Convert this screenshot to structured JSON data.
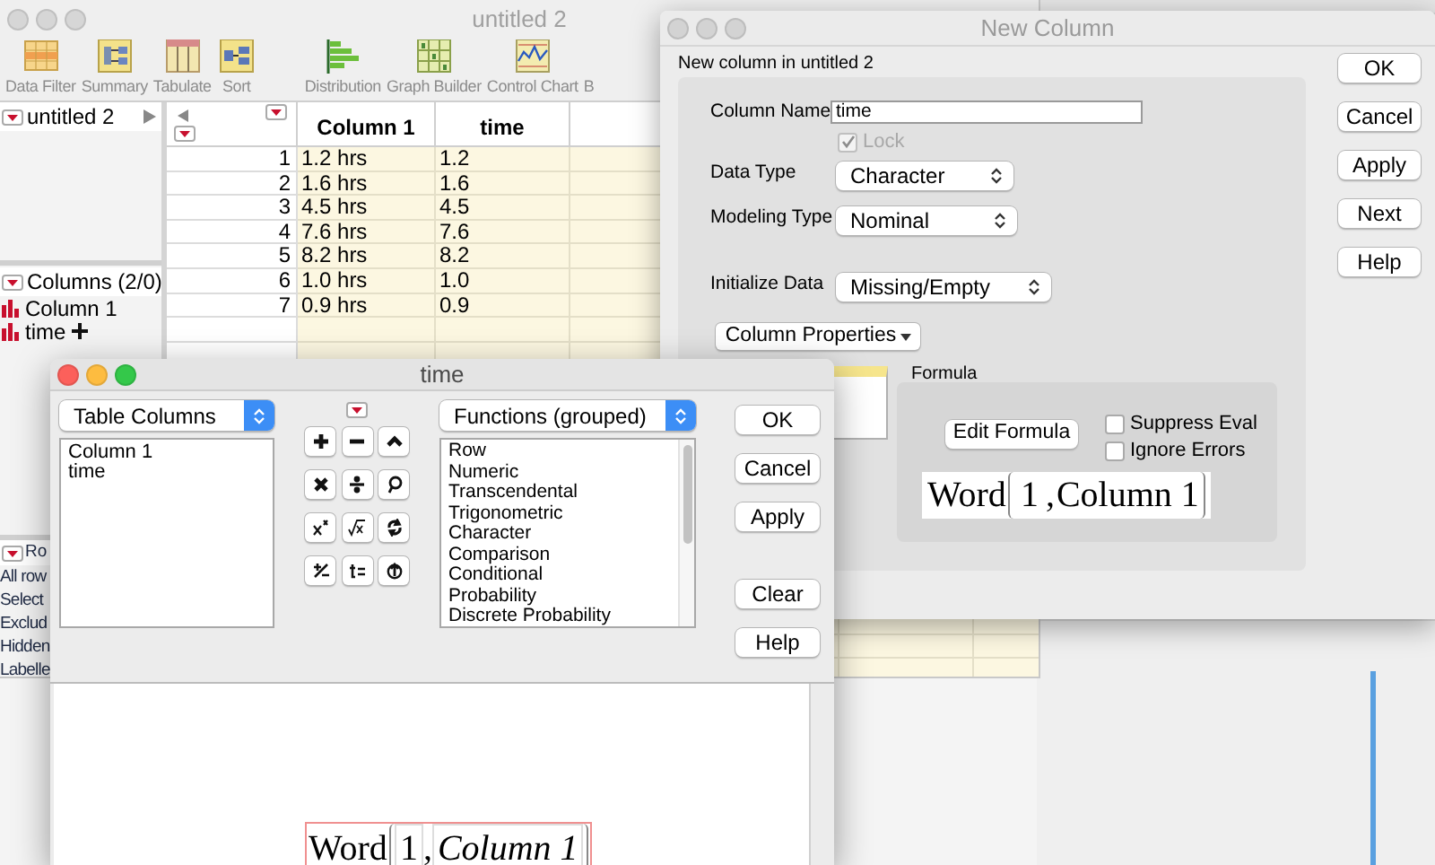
{
  "main_window": {
    "title": "untitled 2",
    "toolbar": [
      {
        "label": "Data Filter",
        "kind": "filter"
      },
      {
        "label": "Summary",
        "kind": "summary"
      },
      {
        "label": "Tabulate",
        "kind": "tabulate"
      },
      {
        "label": "Sort",
        "kind": "sort"
      },
      {
        "label": "Distribution",
        "kind": "distribution"
      },
      {
        "label": "Graph Builder",
        "kind": "graph"
      },
      {
        "label": "Control Chart",
        "kind": "control"
      },
      {
        "label": "B",
        "kind": "covered"
      }
    ],
    "tables_panel": {
      "name": "untitled 2"
    },
    "columns_panel": {
      "title": "Columns (2/0)",
      "columns": [
        {
          "name": "Column 1",
          "has_formula": false
        },
        {
          "name": "time",
          "has_formula": true
        }
      ]
    },
    "rows_panel": {
      "title": "Ro",
      "items": [
        "All row",
        "Select",
        "Exclud",
        "Hidden",
        "Labelle"
      ]
    },
    "table": {
      "columns": [
        "Column 1",
        "time"
      ],
      "rows": [
        {
          "number": "1",
          "cells": [
            "1.2 hrs",
            "1.2"
          ]
        },
        {
          "number": "2",
          "cells": [
            "1.6 hrs",
            "1.6"
          ]
        },
        {
          "number": "3",
          "cells": [
            "4.5 hrs",
            "4.5"
          ]
        },
        {
          "number": "4",
          "cells": [
            "7.6 hrs",
            "7.6"
          ]
        },
        {
          "number": "5",
          "cells": [
            "8.2 hrs",
            "8.2"
          ]
        },
        {
          "number": "6",
          "cells": [
            "1.0 hrs",
            "1.0"
          ]
        },
        {
          "number": "7",
          "cells": [
            "0.9 hrs",
            "0.9"
          ]
        }
      ]
    }
  },
  "new_column_dialog": {
    "title": "New Column",
    "subtitle": "New column in untitled 2",
    "column_name": {
      "label": "Column Name",
      "value": "time"
    },
    "lock": {
      "label": "Lock",
      "checked": true,
      "disabled": true
    },
    "data_type": {
      "label": "Data Type",
      "value": "Character"
    },
    "modeling_type": {
      "label": "Modeling Type",
      "value": "Nominal"
    },
    "initialize_data": {
      "label": "Initialize Data",
      "value": "Missing/Empty"
    },
    "column_properties": "Column Properties",
    "formula_section": {
      "title": "Formula",
      "edit_button": "Edit Formula",
      "options": [
        {
          "label": "Suppress Eval",
          "checked": false
        },
        {
          "label": "Ignore Errors",
          "checked": false
        }
      ],
      "formula": {
        "function": "Word",
        "separator": ",",
        "args": [
          {
            "text": "1",
            "kind": "number"
          },
          {
            "text": "Column 1",
            "kind": "column"
          }
        ]
      }
    },
    "buttons": [
      "OK",
      "Cancel",
      "Apply",
      "Next",
      "Help"
    ]
  },
  "formula_dialog": {
    "title": "time",
    "columns_source": "Table Columns",
    "columns": [
      "Column 1",
      "time"
    ],
    "operators": [
      {
        "kind": "plus"
      },
      {
        "kind": "minus"
      },
      {
        "kind": "caret"
      },
      {
        "kind": "times"
      },
      {
        "kind": "divide"
      },
      {
        "kind": "lasso"
      },
      {
        "kind": "power"
      },
      {
        "kind": "root"
      },
      {
        "kind": "swap"
      },
      {
        "kind": "plusminus"
      },
      {
        "kind": "assign"
      },
      {
        "kind": "raise"
      }
    ],
    "functions_source": "Functions (grouped)",
    "functions": [
      "Row",
      "Numeric",
      "Transcendental",
      "Trigonometric",
      "Character",
      "Comparison",
      "Conditional",
      "Probability",
      "Discrete Probability"
    ],
    "buttons": [
      "OK",
      "Cancel",
      "Apply"
    ],
    "lower_buttons": [
      "Clear",
      "Help"
    ],
    "formula": {
      "function": "Word",
      "separator": ",",
      "args": [
        {
          "text": "1",
          "kind": "number"
        },
        {
          "text": "Column 1",
          "kind": "column"
        }
      ]
    }
  }
}
